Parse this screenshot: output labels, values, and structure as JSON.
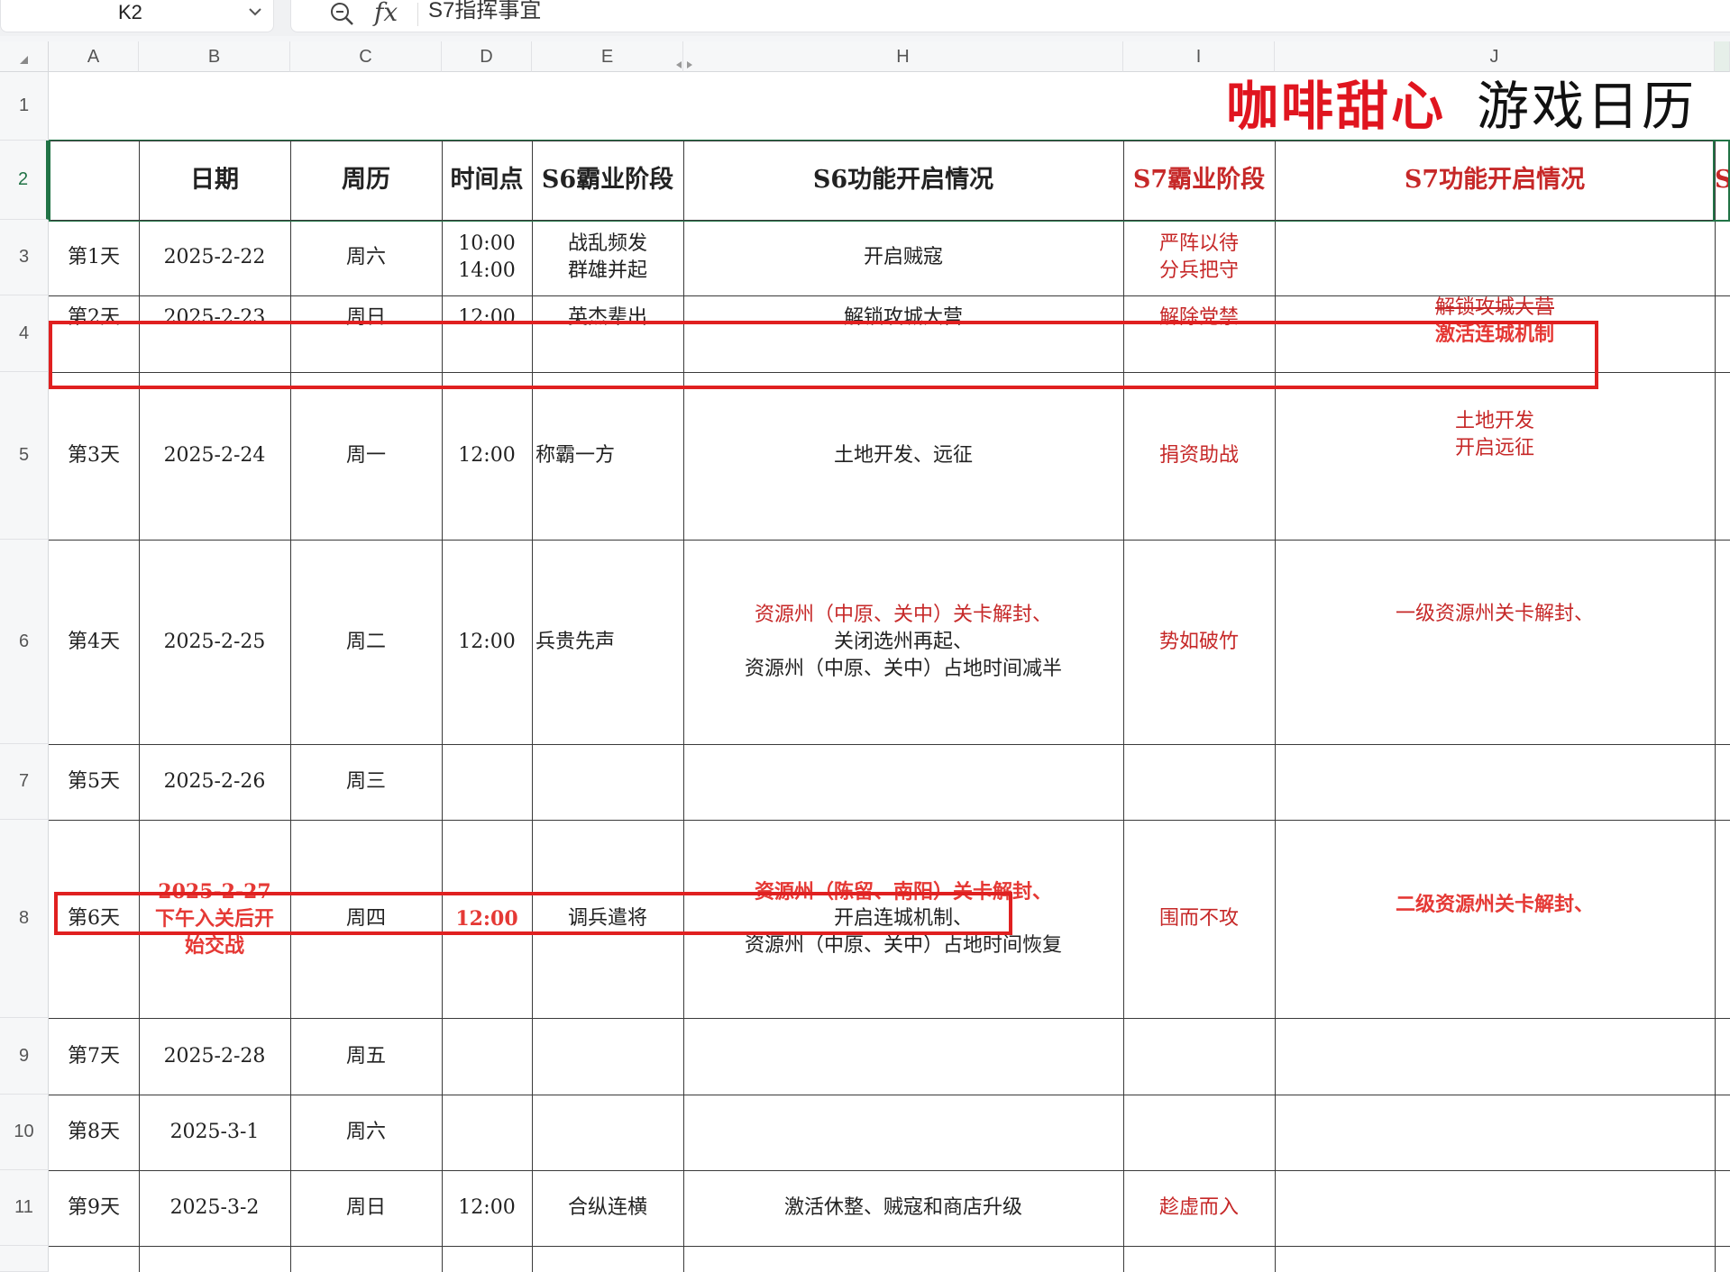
{
  "name_box": {
    "value": "K2"
  },
  "formula_bar": {
    "content": "S7指挥事宜",
    "fx_label": "fx"
  },
  "columns": [
    "A",
    "B",
    "C",
    "D",
    "E",
    "H",
    "I",
    "J"
  ],
  "rows": [
    "1",
    "2",
    "3",
    "4",
    "5",
    "6",
    "7",
    "8",
    "9",
    "10",
    "11"
  ],
  "title": {
    "part1": "咖啡甜心",
    "part2": "游戏日历"
  },
  "headers": {
    "date": "日期",
    "weekday": "周历",
    "time": "时间点",
    "s6_stage": "S6霸业阶段",
    "s6_features": "S6功能开启情况",
    "s7_stage": "S7霸业阶段",
    "s7_features": "S7功能开启情况",
    "k_partial": "S"
  },
  "data_rows": [
    {
      "day": "第1天",
      "date": "2025-2-22",
      "weekday": "周六",
      "time": "10:00\n14:00",
      "s6_stage": "战乱频发\n群雄并起",
      "s6_features": "开启贼寇",
      "s7_stage": "严阵以待\n分兵把守",
      "s7_features": ""
    },
    {
      "day": "第2天",
      "date": "2025-2-23",
      "weekday": "周日",
      "time": "12:00",
      "s6_stage": "英杰辈出",
      "s6_features": "解锁攻城大营",
      "s7_stage": "解除党禁",
      "s7_features_line1": "解锁攻城大营",
      "s7_features_line2": "激活连城机制"
    },
    {
      "day": "第3天",
      "date": "2025-2-24",
      "weekday": "周一",
      "time": "12:00",
      "s6_stage": "称霸一方",
      "s6_features": "土地开发、远征",
      "s7_stage": "捐资助战",
      "s7_features": "土地开发\n开启远征"
    },
    {
      "day": "第4天",
      "date": "2025-2-25",
      "weekday": "周二",
      "time": "12:00",
      "s6_stage": "兵贵先声",
      "s6_features_line1": "资源州（中原、关中）关卡解封、",
      "s6_features_line2": "关闭选州再起、\n资源州（中原、关中）占地时间减半",
      "s7_stage": "势如破竹",
      "s7_features": "一级资源州关卡解封、"
    },
    {
      "day": "第5天",
      "date": "2025-2-26",
      "weekday": "周三",
      "time": "",
      "s6_stage": "",
      "s6_features": "",
      "s7_stage": "",
      "s7_features": ""
    },
    {
      "day": "第6天",
      "date": "2025-2-27\n下午入关后开\n始交战",
      "weekday": "周四",
      "time": "12:00",
      "s6_stage": "调兵遣将",
      "s6_features_line1": "资源州（陈留、南阳）关卡解封、",
      "s6_features_line2": "开启连城机制、\n资源州（中原、关中）占地时间恢复",
      "s7_stage": "围而不攻",
      "s7_features": "二级资源州关卡解封、"
    },
    {
      "day": "第7天",
      "date": "2025-2-28",
      "weekday": "周五",
      "time": "",
      "s6_stage": "",
      "s6_features": "",
      "s7_stage": "",
      "s7_features": ""
    },
    {
      "day": "第8天",
      "date": "2025-3-1",
      "weekday": "周六",
      "time": "",
      "s6_stage": "",
      "s6_features": "",
      "s7_stage": "",
      "s7_features": ""
    },
    {
      "day": "第9天",
      "date": "2025-3-2",
      "weekday": "周日",
      "time": "12:00",
      "s6_stage": "合纵连横",
      "s6_features": "激活休整、贼寇和商店升级",
      "s7_stage": "趁虚而入",
      "s7_features": ""
    }
  ]
}
